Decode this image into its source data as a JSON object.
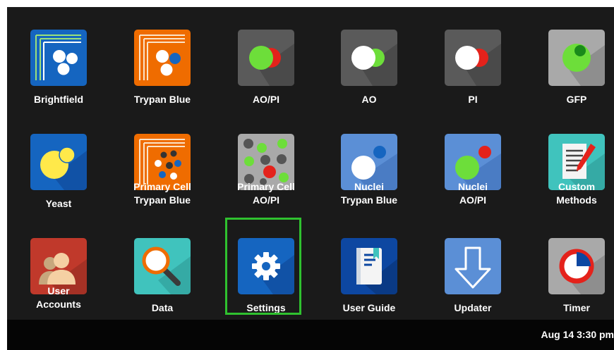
{
  "apps": [
    {
      "label": "Brightfield",
      "icon": "brightfield-icon"
    },
    {
      "label": "Trypan Blue",
      "icon": "trypan-blue-icon"
    },
    {
      "label": "AO/PI",
      "icon": "ao-pi-icon"
    },
    {
      "label": "AO",
      "icon": "ao-icon"
    },
    {
      "label": "PI",
      "icon": "pi-icon"
    },
    {
      "label": "GFP",
      "icon": "gfp-icon"
    },
    {
      "label": "Yeast",
      "icon": "yeast-icon"
    },
    {
      "label": "Primary Cell\nTrypan Blue",
      "icon": "primary-cell-trypan-blue-icon"
    },
    {
      "label": "Primary Cell\nAO/PI",
      "icon": "primary-cell-ao-pi-icon"
    },
    {
      "label": "Nuclei\nTrypan Blue",
      "icon": "nuclei-trypan-blue-icon"
    },
    {
      "label": "Nuclei\nAO/PI",
      "icon": "nuclei-ao-pi-icon"
    },
    {
      "label": "Custom\nMethods",
      "icon": "custom-methods-icon"
    },
    {
      "label": "User\nAccounts",
      "icon": "user-accounts-icon"
    },
    {
      "label": "Data",
      "icon": "data-search-icon"
    },
    {
      "label": "Settings",
      "icon": "gear-icon",
      "selected": true
    },
    {
      "label": "User Guide",
      "icon": "book-icon"
    },
    {
      "label": "Updater",
      "icon": "download-arrow-icon"
    },
    {
      "label": "Timer",
      "icon": "timer-icon"
    }
  ],
  "status": {
    "time": "Aug 14 3:30 pm"
  },
  "colors": {
    "background": "#1a1a1a",
    "statusbar": "#050505",
    "selection": "#2fc12f",
    "blue_tile": "#1565c0",
    "orange_tile": "#ef6c00",
    "gray_tile": "#5a5a5a"
  }
}
